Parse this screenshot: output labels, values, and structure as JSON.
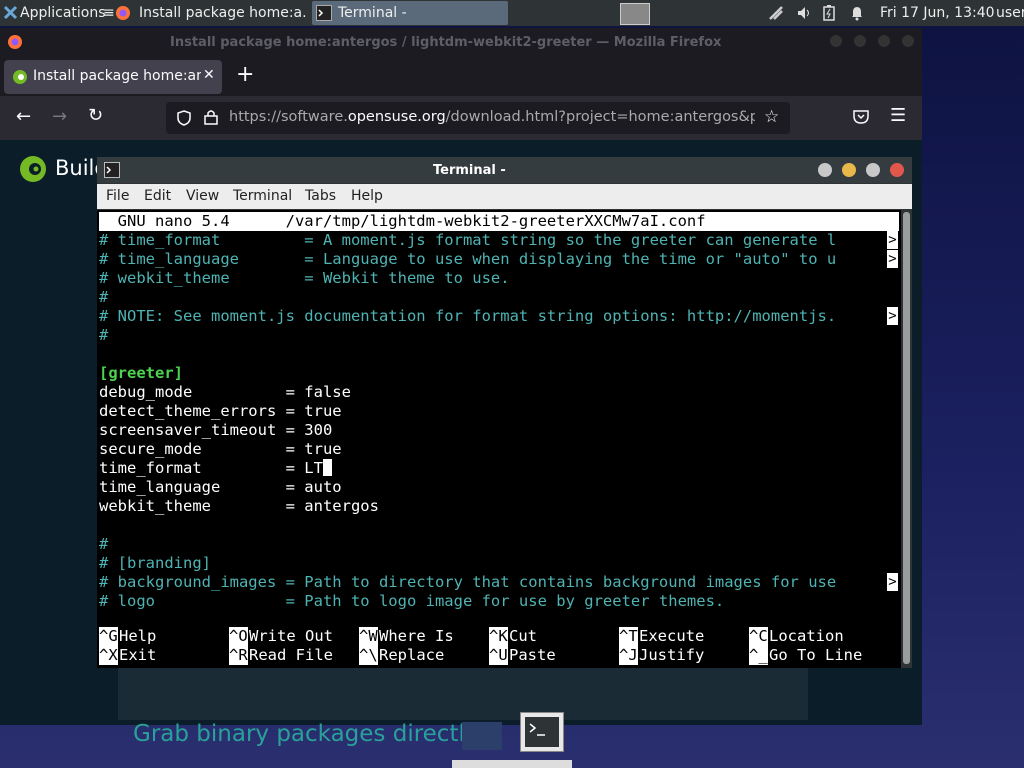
{
  "panel": {
    "applications_label": "Applications",
    "tasks": [
      {
        "label": "Install package home:a...",
        "icon": "firefox-icon"
      },
      {
        "label": "Terminal -",
        "icon": "terminal-icon"
      }
    ],
    "clock": "Fri 17 Jun, 13:40",
    "user": "user"
  },
  "firefox": {
    "window_title": "Install package home:antergos / lightdm-webkit2-greeter — Mozilla Firefox",
    "tab_label": "Install package home:ant",
    "url_prefix": "https://software.",
    "url_domain": "opensuse.org",
    "url_rest": "/download.html?project=home:antergos&pac",
    "page_brand": "Build",
    "page_heading": "Grab binary packages directly"
  },
  "terminal": {
    "title": "Terminal -",
    "menu": [
      "File",
      "Edit",
      "View",
      "Terminal",
      "Tabs",
      "Help"
    ],
    "nano_header": "  GNU nano 5.4      /var/tmp/lightdm-webkit2-greeterXXCMw7aI.conf",
    "lines": [
      {
        "text": "# time_format         = A moment.js format string so the greeter can generate l",
        "kind": "cmt",
        "over": true
      },
      {
        "text": "# time_language       = Language to use when displaying the time or \"auto\" to u",
        "kind": "cmt",
        "over": true
      },
      {
        "text": "# webkit_theme        = Webkit theme to use.",
        "kind": "cmt"
      },
      {
        "text": "#",
        "kind": "cmt"
      },
      {
        "text": "# NOTE: See moment.js documentation for format string options: http://momentjs.",
        "kind": "cmt",
        "over": true
      },
      {
        "text": "#",
        "kind": "cmt"
      },
      {
        "text": "",
        "kind": "plain"
      },
      {
        "text": "[greeter]",
        "kind": "sect"
      },
      {
        "text": "debug_mode          = false",
        "kind": "plain"
      },
      {
        "text": "detect_theme_errors = true",
        "kind": "plain"
      },
      {
        "text": "screensaver_timeout = 300",
        "kind": "plain"
      },
      {
        "text": "secure_mode         = true",
        "kind": "plain"
      },
      {
        "text": "time_format         = LT",
        "kind": "plain",
        "cursor": true
      },
      {
        "text": "time_language       = auto",
        "kind": "plain"
      },
      {
        "text": "webkit_theme        = antergos",
        "kind": "plain"
      },
      {
        "text": "",
        "kind": "plain"
      },
      {
        "text": "#",
        "kind": "cmt"
      },
      {
        "text": "# [branding]",
        "kind": "cmt"
      },
      {
        "text": "# background_images = Path to directory that contains background images for use",
        "kind": "cmt",
        "over": true
      },
      {
        "text": "# logo              = Path to logo image for use by greeter themes.",
        "kind": "cmt"
      }
    ],
    "overflow_marker": ">",
    "shortcuts_row1": [
      {
        "key": "^G",
        "label": "Help"
      },
      {
        "key": "^O",
        "label": "Write Out"
      },
      {
        "key": "^W",
        "label": "Where Is"
      },
      {
        "key": "^K",
        "label": "Cut"
      },
      {
        "key": "^T",
        "label": "Execute"
      },
      {
        "key": "^C",
        "label": "Location"
      }
    ],
    "shortcuts_row2": [
      {
        "key": "^X",
        "label": "Exit"
      },
      {
        "key": "^R",
        "label": "Read File"
      },
      {
        "key": "^\\",
        "label": "Replace"
      },
      {
        "key": "^U",
        "label": "Paste"
      },
      {
        "key": "^J",
        "label": "Justify"
      },
      {
        "key": "^_",
        "label": "Go To Line"
      }
    ]
  },
  "colors": {
    "comment": "#4fb3b3",
    "section": "#4ed34e",
    "page_heading": "#2aa198"
  }
}
